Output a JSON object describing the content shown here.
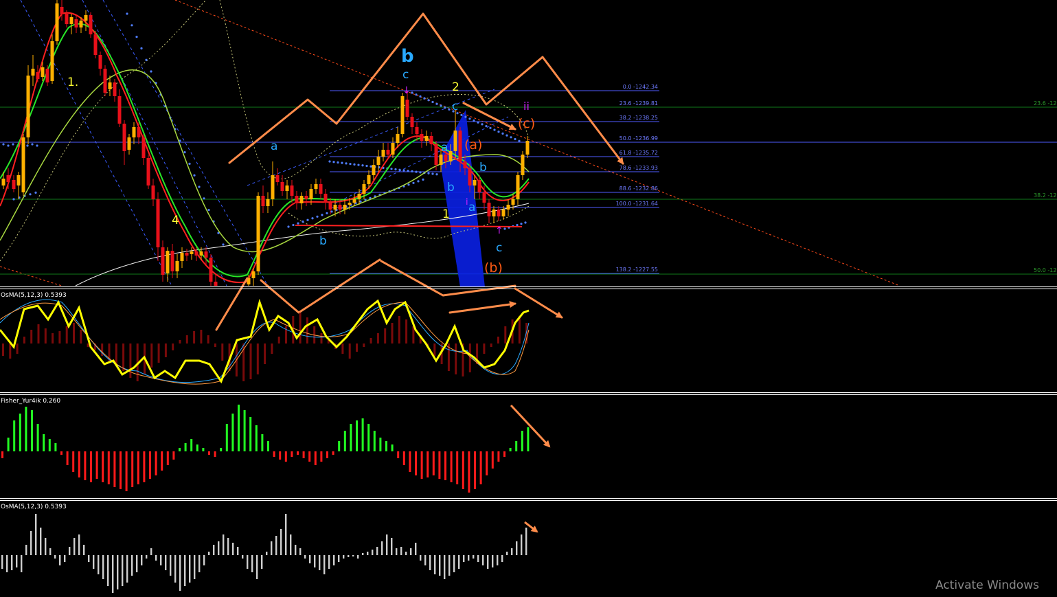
{
  "colors": {
    "background": "#000000",
    "panel_separator": "#ffffff",
    "bull_candle": "#ffb000",
    "bear_candle": "#e8101a",
    "fib_line": "#4f5bff",
    "fib_text": "#6f7bff",
    "level_line": "#0f7a1a",
    "level_text": "#2c9a2c",
    "arrow": "#ff8c4a",
    "wave_cyan": "#29a9ff",
    "wave_yellow": "#ffff33",
    "wave_orange": "#ff5a14",
    "wave_magenta": "#d020ff",
    "hist_green": "#22ff22",
    "hist_red": "#ff1a1a",
    "hist_gray": "#cfcfcf",
    "osma_line": "#ffff00"
  },
  "fib_levels": [
    {
      "label": "0.0 -1242.34"
    },
    {
      "label": "23.6 -1239.81"
    },
    {
      "label": "38.2 -1238.25"
    },
    {
      "label": "50.0 -1236.99"
    },
    {
      "label": "61.8 -1235.72"
    },
    {
      "label": "78.6 -1233.93"
    },
    {
      "label": "88.6 -1232.86"
    },
    {
      "label": "100.0 -1231.64"
    },
    {
      "label": "138.2 -1227.55"
    }
  ],
  "right_levels": [
    {
      "label": "23.6 -12"
    },
    {
      "label": "38.2 -12"
    },
    {
      "label": "50.0 -12"
    }
  ],
  "wave_labels": {
    "b_big": "b",
    "c_top": "c",
    "two": "2",
    "c_second": "c",
    "ii": "ii",
    "c_paren": "(c)",
    "a_paren": "(a)",
    "a_left": "a",
    "a_mid": "a",
    "b_mid": "b",
    "b_mid2": "b",
    "b_low": "b",
    "one_low": "1",
    "a_low": "a",
    "i_low": "i",
    "c_bottom": "c",
    "b_paren": "(b)",
    "one_left": "1.",
    "four": "4"
  },
  "indicators": {
    "osma_top": "OsMA(5,12,3) 0.5393",
    "fisher": "Fisher_Yur4ik 0.260",
    "osma_bottom": "OsMA(5,12,3) 0.5393"
  },
  "watermark": "Activate Windows"
}
